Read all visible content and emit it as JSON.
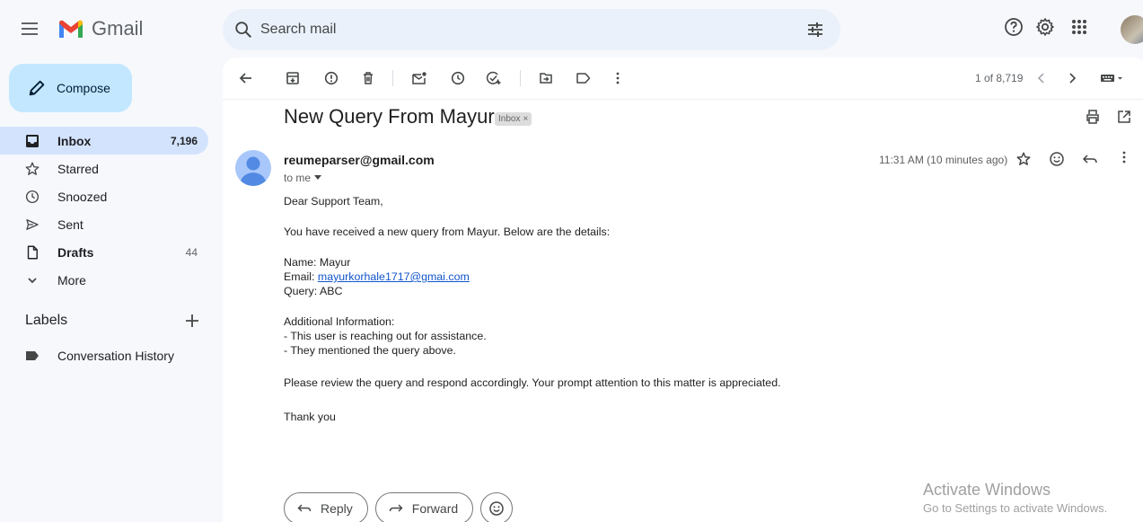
{
  "app": {
    "name": "Gmail"
  },
  "search": {
    "placeholder": "Search mail"
  },
  "compose": {
    "label": "Compose"
  },
  "nav": {
    "inbox": {
      "label": "Inbox",
      "count": "7,196"
    },
    "starred": {
      "label": "Starred"
    },
    "snoozed": {
      "label": "Snoozed"
    },
    "sent": {
      "label": "Sent"
    },
    "drafts": {
      "label": "Drafts",
      "count": "44"
    },
    "more": {
      "label": "More"
    }
  },
  "labels": {
    "heading": "Labels",
    "items": [
      {
        "label": "Conversation History"
      }
    ]
  },
  "toolbar": {
    "pager": "1 of 8,719"
  },
  "email": {
    "subject": "New Query From Mayur",
    "chip": "Inbox",
    "chip_close": "×",
    "sender": "reumeparser@gmail.com",
    "to": "to me",
    "time": "11:31 AM (10 minutes ago)",
    "body": {
      "greeting": "Dear Support Team,",
      "intro": "You have received a new query from Mayur. Below are the details:",
      "name_line": "Name: Mayur",
      "email_prefix": "Email: ",
      "email_link": "mayurkorhale1717@gmai.com",
      "query_line": "Query: ABC",
      "additional_heading": "Additional Information:",
      "bullet1": "- This user is reaching out for assistance.",
      "bullet2": "- They mentioned the query above.",
      "closing": "Please review the query and respond accordingly. Your prompt attention to this matter is appreciated.",
      "signoff": "Thank you"
    }
  },
  "actions": {
    "reply": "Reply",
    "forward": "Forward"
  },
  "watermark": {
    "title": "Activate Windows",
    "subtitle": "Go to Settings to activate Windows."
  },
  "colors": {
    "accent": "#0b57d0",
    "compose_bg": "#c2e7ff",
    "active_nav": "#d3e3fd",
    "link": "#1155cc"
  }
}
